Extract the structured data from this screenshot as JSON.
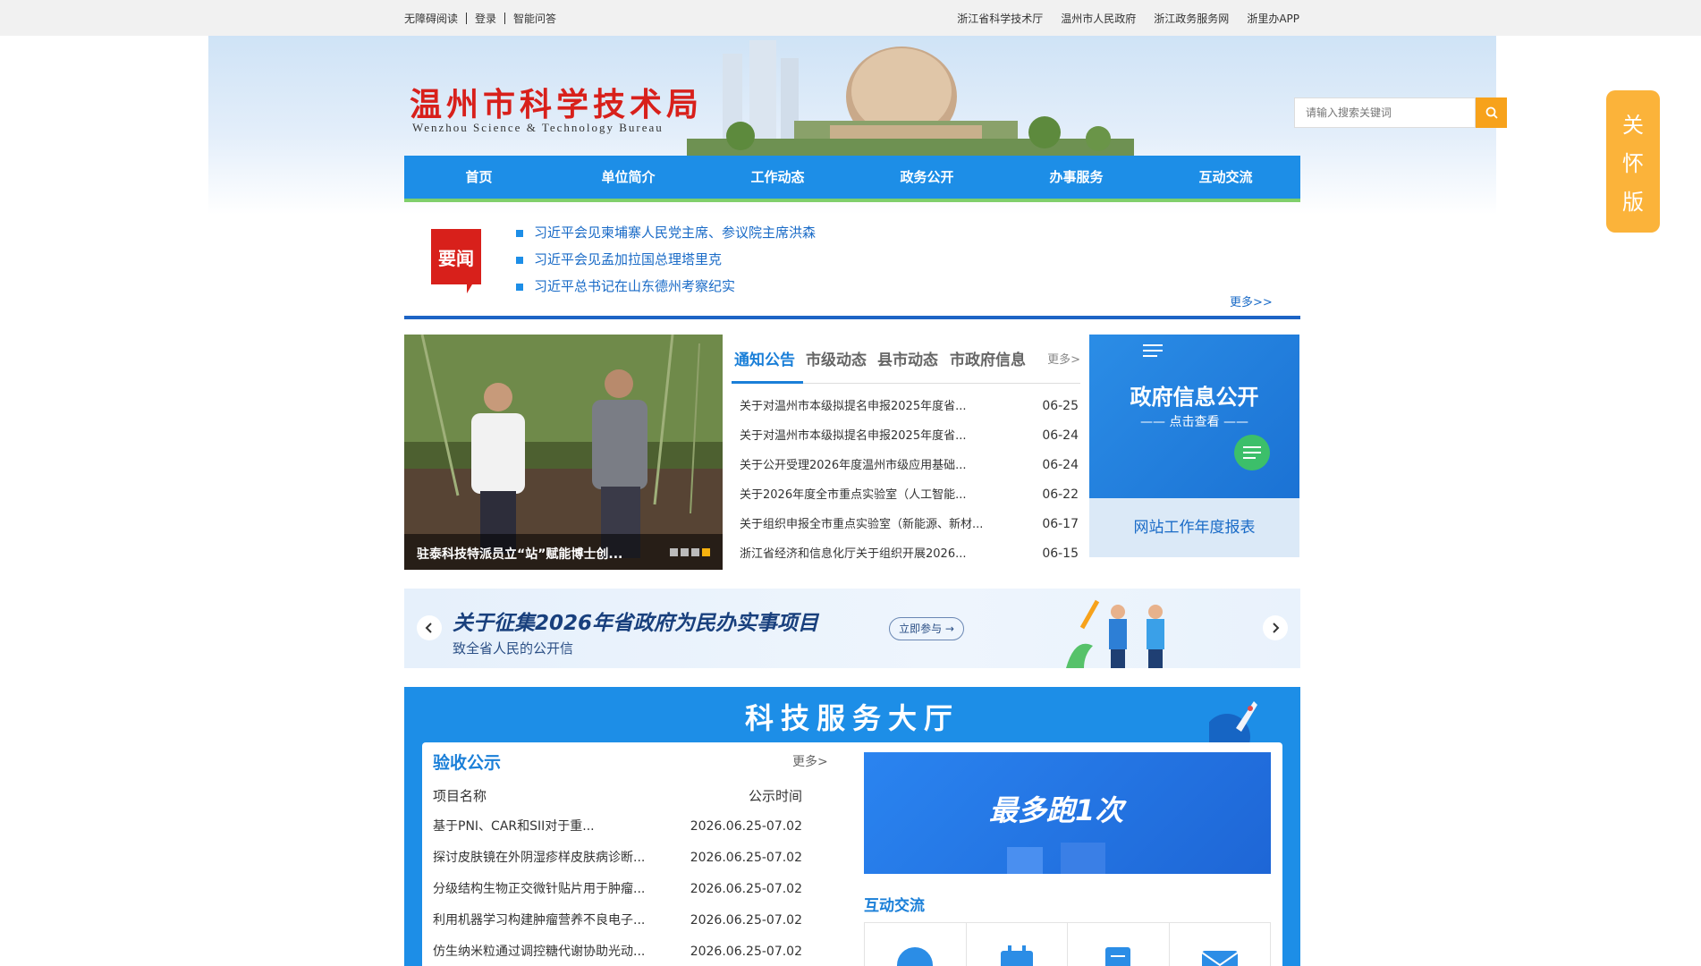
{
  "topbar": {
    "left_links": [
      "无障碍阅读",
      "登录",
      "智能问答"
    ],
    "right_links": [
      "浙江省科学技术厅",
      "温州市人民政府",
      "浙江政务服务网",
      "浙里办APP"
    ]
  },
  "header": {
    "title": "温州市科学技术局",
    "subtitle": "Wenzhou Science & Technology Bureau",
    "search_placeholder": "请输入搜索关键词",
    "search_icon": "search-icon"
  },
  "nav": [
    "首页",
    "单位简介",
    "工作动态",
    "政务公开",
    "办事服务",
    "互动交流"
  ],
  "care_mode": [
    "关",
    "怀",
    "版"
  ],
  "headline_news": {
    "badge": "要闻",
    "items": [
      "习近平会见柬埔寨人民党主席、参议院主席洪森",
      "习近平会见孟加拉国总理塔里克",
      "习近平总书记在山东德州考察纪实"
    ],
    "more": "更多>>"
  },
  "photo": {
    "caption": "驻泰科技特派员立“站”赋能博士创...",
    "slides": 4,
    "active_slide": 4
  },
  "notice": {
    "tabs": [
      "通知公告",
      "市级动态",
      "县市动态",
      "市政府信息"
    ],
    "active_tab": "通知公告",
    "more": "更多>",
    "items": [
      {
        "title": "关于对温州市本级拟提名申报2025年度省...",
        "date": "06-25"
      },
      {
        "title": "关于对温州市本级拟提名申报2025年度省...",
        "date": "06-24"
      },
      {
        "title": "关于公开受理2026年度温州市级应用基础...",
        "date": "06-24"
      },
      {
        "title": "关于2026年度全市重点实验室（人工智能...",
        "date": "06-22"
      },
      {
        "title": "关于组织申报全市重点实验室（新能源、新材...",
        "date": "06-17"
      },
      {
        "title": "浙江省经济和信息化厅关于组织开展2026...",
        "date": "06-15"
      }
    ]
  },
  "gov_info": {
    "title": "政府信息公开",
    "sub": "点击查看",
    "annual_report": "网站工作年度报表"
  },
  "banner": {
    "title": "关于征集2026年省政府为民办实事项目",
    "sub": "致全省人民的公开信",
    "join": "立即参与 →"
  },
  "service_hall": {
    "title": "科技服务大厅",
    "acceptance": {
      "title": "验收公示",
      "more": "更多>",
      "col_name": "项目名称",
      "col_time": "公示时间",
      "rows": [
        {
          "name": "基于PNI、CAR和SII对于重...",
          "time": "2026.06.25-07.02"
        },
        {
          "name": "探讨皮肤镜在外阴湿疹样皮肤病诊断...",
          "time": "2026.06.25-07.02"
        },
        {
          "name": "分级结构生物正交微针贴片用于肿瘤...",
          "time": "2026.06.25-07.02"
        },
        {
          "name": "利用机器学习构建肿瘤营养不良电子...",
          "time": "2026.06.25-07.02"
        },
        {
          "name": "仿生纳米粒通过调控糖代谢协助光动...",
          "time": "2026.06.25-07.02"
        }
      ]
    },
    "most_run": "最多跑1次",
    "interaction": {
      "title": "互动交流",
      "icons": [
        "person-icon",
        "calendar-icon",
        "document-icon",
        "mail-icon"
      ]
    }
  },
  "colors": {
    "nav_blue": "#1d8ee7",
    "title_red": "#d8201b",
    "search_orange": "#f7a21b",
    "care_yellow": "#fbb33a",
    "link_blue": "#1a6bc7"
  }
}
